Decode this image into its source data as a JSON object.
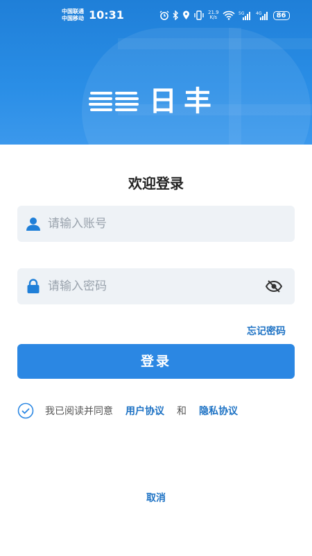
{
  "status_bar": {
    "carrier_1": "中国联通",
    "carrier_2": "中国移动",
    "time": "10:31",
    "network_speed_value": "21.9",
    "network_speed_unit": "K/s",
    "battery": "86",
    "icons": [
      "alarm-icon",
      "bluetooth-icon",
      "location-icon",
      "vibrate-icon",
      "wifi-icon",
      "signal-5g-icon",
      "signal-4g-icon",
      "battery-icon"
    ]
  },
  "header": {
    "logo_text": "日丰",
    "accent_color": "#2a8ee6"
  },
  "login": {
    "title": "欢迎登录",
    "account_placeholder": "请输入账号",
    "password_placeholder": "请输入密码",
    "forgot_password": "忘记密码",
    "login_button": "登录"
  },
  "agreement": {
    "prefix": "我已阅读并同意",
    "user_agreement": "用户协议",
    "and": "和",
    "privacy_policy": "隐私协议",
    "checked": true
  },
  "cancel": "取消",
  "colors": {
    "primary": "#2b87e3",
    "link": "#1d72c4",
    "field_bg": "#eef2f6"
  }
}
